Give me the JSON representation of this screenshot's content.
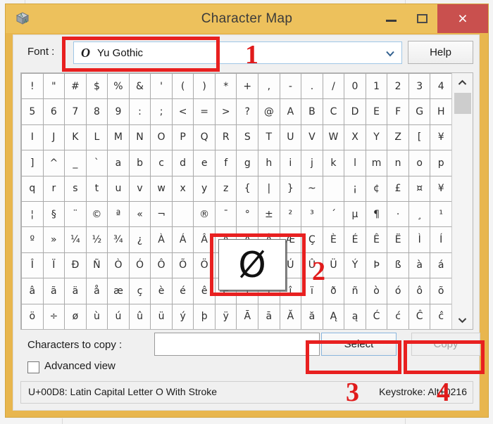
{
  "window": {
    "title": "Character Map",
    "app_icon": "character-map-icon",
    "titlebar_color": "#edc15c",
    "close_button_color": "#c9504e",
    "controls": {
      "minimize": "minimize-icon",
      "maximize": "maximize-icon",
      "close": "×"
    }
  },
  "font_row": {
    "label": "Font :",
    "selected_font": "Yu Gothic",
    "truetype_icon_glyph": "O",
    "dropdown_icon": "chevron-down-icon",
    "help_label": "Help"
  },
  "grid": {
    "rows": [
      [
        "!",
        "\"",
        "#",
        "$",
        "%",
        "&",
        "'",
        "(",
        ")",
        "*",
        "+",
        ",",
        "-",
        ".",
        "/",
        "0",
        "1",
        "2",
        "3",
        "4"
      ],
      [
        "5",
        "6",
        "7",
        "8",
        "9",
        ":",
        ";",
        "<",
        "=",
        ">",
        "?",
        "@",
        "A",
        "B",
        "C",
        "D",
        "E",
        "F",
        "G",
        "H"
      ],
      [
        "I",
        "J",
        "K",
        "L",
        "M",
        "N",
        "O",
        "P",
        "Q",
        "R",
        "S",
        "T",
        "U",
        "V",
        "W",
        "X",
        "Y",
        "Z",
        "[",
        "¥"
      ],
      [
        "]",
        "^",
        "_",
        "`",
        "a",
        "b",
        "c",
        "d",
        "e",
        "f",
        "g",
        "h",
        "i",
        "j",
        "k",
        "l",
        "m",
        "n",
        "o",
        "p"
      ],
      [
        "q",
        "r",
        "s",
        "t",
        "u",
        "v",
        "w",
        "x",
        "y",
        "z",
        "{",
        "|",
        "}",
        "~",
        " ",
        "¡",
        "¢",
        "£",
        "¤",
        "¥"
      ],
      [
        "¦",
        "§",
        "¨",
        "©",
        "ª",
        "«",
        "¬",
        "­",
        "®",
        "¯",
        "°",
        "±",
        "²",
        "³",
        "´",
        "µ",
        "¶",
        "·",
        "¸",
        "¹"
      ],
      [
        "º",
        "»",
        "¼",
        "½",
        "¾",
        "¿",
        "À",
        "Á",
        "Â",
        "Ã",
        "Ä",
        "Å",
        "Æ",
        "Ç",
        "È",
        "É",
        "Ê",
        "Ë",
        "Ì",
        "Í"
      ],
      [
        "Î",
        "Ï",
        "Ð",
        "Ñ",
        "Ò",
        "Ó",
        "Ô",
        "Õ",
        "Ö",
        "×",
        "Ø",
        "Ù",
        "Ú",
        "Û",
        "Ü",
        "Ý",
        "Þ",
        "ß",
        "à",
        "á"
      ],
      [
        "â",
        "ã",
        "ä",
        "å",
        "æ",
        "ç",
        "è",
        "é",
        "ê",
        "ë",
        "ì",
        "í",
        "î",
        "ï",
        "ð",
        "ñ",
        "ò",
        "ó",
        "ô",
        "õ"
      ],
      [
        "ö",
        "÷",
        "ø",
        "ù",
        "ú",
        "û",
        "ü",
        "ý",
        "þ",
        "ÿ",
        "Ā",
        "ā",
        "Ă",
        "ă",
        "Ą",
        "ą",
        "Ć",
        "ć",
        "Ĉ",
        "ĉ"
      ]
    ],
    "scrollbar": {
      "up_icon": "chevron-up-icon",
      "down_icon": "chevron-down-icon",
      "thumb_position": "top"
    }
  },
  "magnified": {
    "character": "Ø"
  },
  "bottom": {
    "copy_label": "Characters to copy :",
    "copy_field_value": "",
    "copy_field_placeholder": "",
    "select_label": "Select",
    "copy_button_label": "Copy",
    "advanced_view_label": "Advanced view",
    "advanced_view_checked": false
  },
  "status": {
    "left": "U+00D8: Latin Capital Letter O With Stroke",
    "right": "Keystroke: Alt+0216"
  },
  "annotations": {
    "color": "#e82020",
    "markers": [
      {
        "number": "1",
        "target": "font-combo"
      },
      {
        "number": "2",
        "target": "magnified-character"
      },
      {
        "number": "3",
        "target": "select-button"
      },
      {
        "number": "4",
        "target": "copy-button"
      }
    ]
  }
}
